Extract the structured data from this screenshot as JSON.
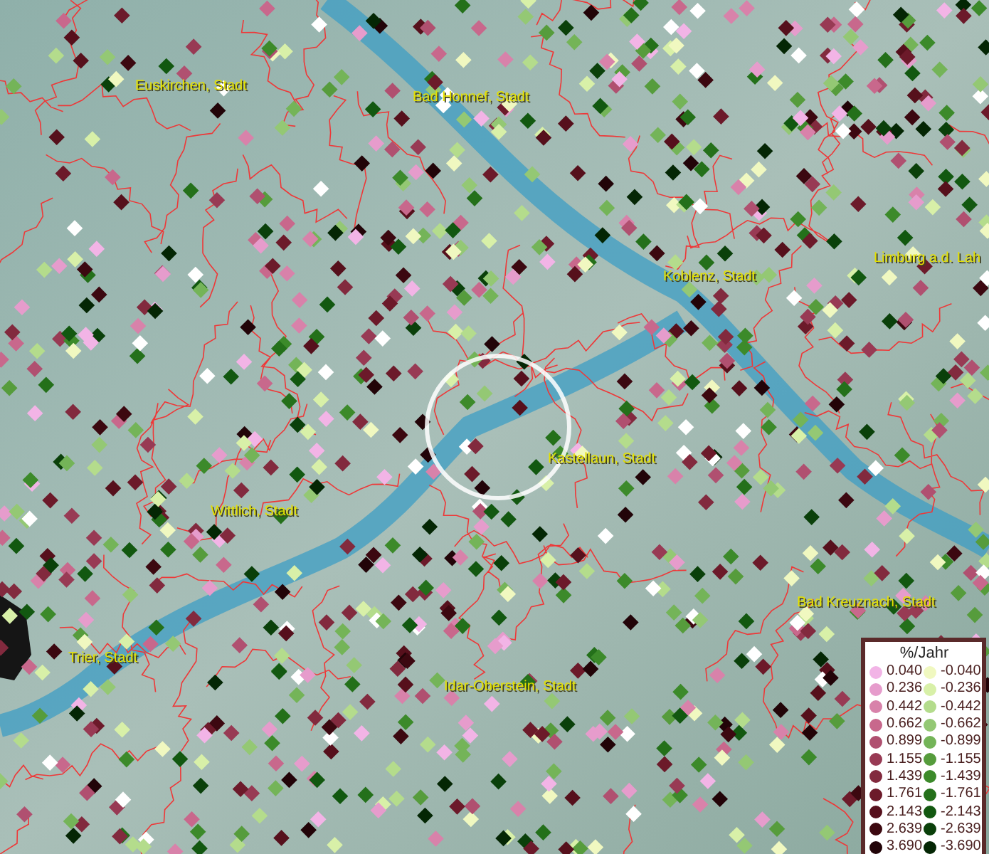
{
  "map": {
    "cities": [
      {
        "name": "Euskirchen, Stadt"
      },
      {
        "name": "Bad Honnef, Stadt"
      },
      {
        "name": "Koblenz, Stadt"
      },
      {
        "name": "Limburg a.d. Lah"
      },
      {
        "name": "Kastellaun, Stadt"
      },
      {
        "name": "Wittlich, Stadt"
      },
      {
        "name": "Bad Kreuznach, Stadt"
      },
      {
        "name": "Trier, Stadt"
      },
      {
        "name": "Idar-Oberstein, Stadt"
      }
    ]
  },
  "legend": {
    "title": "%/Jahr",
    "rows": [
      {
        "left": {
          "label": "0.040",
          "color": "#f2b4e6"
        },
        "right": {
          "label": "-0.040",
          "color": "#f0f8c0"
        }
      },
      {
        "left": {
          "label": "0.236",
          "color": "#e69ccc"
        },
        "right": {
          "label": "-0.236",
          "color": "#d8f0a8"
        }
      },
      {
        "left": {
          "label": "0.442",
          "color": "#d882aa"
        },
        "right": {
          "label": "-0.442",
          "color": "#b4dc8c"
        }
      },
      {
        "left": {
          "label": "0.662",
          "color": "#c8688c"
        },
        "right": {
          "label": "-0.662",
          "color": "#94c874"
        }
      },
      {
        "left": {
          "label": "0.899",
          "color": "#b05070"
        },
        "right": {
          "label": "-0.899",
          "color": "#74b458"
        }
      },
      {
        "left": {
          "label": "1.155",
          "color": "#983a54"
        },
        "right": {
          "label": "-1.155",
          "color": "#569c3c"
        }
      },
      {
        "left": {
          "label": "1.439",
          "color": "#822a3e"
        },
        "right": {
          "label": "-1.439",
          "color": "#3c8a2a"
        }
      },
      {
        "left": {
          "label": "1.761",
          "color": "#6c1a2a"
        },
        "right": {
          "label": "-1.761",
          "color": "#24701a"
        }
      },
      {
        "left": {
          "label": "2.143",
          "color": "#56101c"
        },
        "right": {
          "label": "-2.143",
          "color": "#125810"
        }
      },
      {
        "left": {
          "label": "2.639",
          "color": "#3c0810"
        },
        "right": {
          "label": "-2.639",
          "color": "#0a400a"
        }
      },
      {
        "left": {
          "label": "3.690",
          "color": "#220408"
        },
        "right": {
          "label": "-3.690",
          "color": "#042604"
        }
      }
    ]
  }
}
